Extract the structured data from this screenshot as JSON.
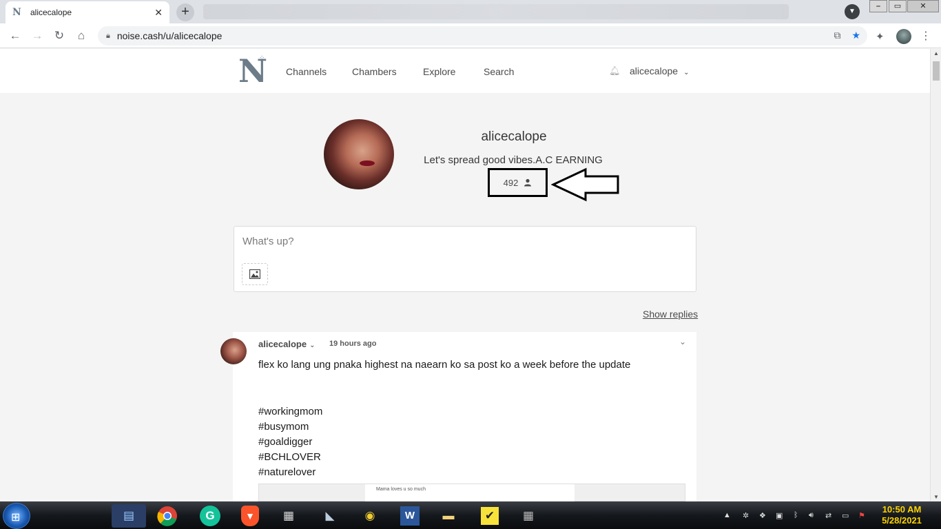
{
  "browser": {
    "tab_title": "alicecalope",
    "tab_close": "✕",
    "new_tab": "+",
    "url": "noise.cash/u/alicecalope",
    "window_controls": {
      "minimize": "⎯",
      "maximize": "▭",
      "close": "✕"
    }
  },
  "site": {
    "logo_letter": "N",
    "nav": [
      "Channels",
      "Chambers",
      "Explore",
      "Search"
    ],
    "username": "alicecalope"
  },
  "profile": {
    "name": "alicecalope",
    "bio": "Let's spread good vibes.A.C EARNING",
    "followers": "492"
  },
  "composer": {
    "placeholder": "What's up?"
  },
  "feed": {
    "show_replies": "Show replies"
  },
  "post": {
    "author": "alicecalope",
    "time": "19 hours ago",
    "text": "flex ko lang ung pnaka highest na naearn ko sa post ko a week before the update",
    "hashtags": [
      "#workingmom",
      "#busymom",
      "#goaldigger",
      "#BCHLOVER",
      "#naturelover"
    ],
    "image_caption": "Mama loves u so much"
  },
  "taskbar": {
    "clock_time": "10:50 AM",
    "clock_date": "5/28/2021"
  },
  "colors": {
    "follower_box_border": "#000000",
    "clock": "#ffd400",
    "page_bg": "#f4f4f4"
  }
}
